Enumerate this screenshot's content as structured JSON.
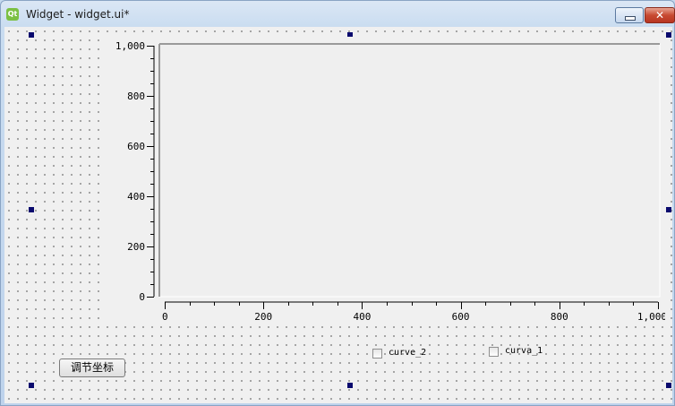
{
  "window": {
    "title": "Widget - widget.ui*",
    "app_icon_text": "Qt",
    "close_glyph": "✕"
  },
  "plot": {
    "y_axis": {
      "min": 0,
      "max": 1000,
      "major_step": 200,
      "minor_step": 50,
      "tick_labels": [
        "0",
        "200",
        "400",
        "600",
        "800",
        "1,000"
      ]
    },
    "x_axis": {
      "min": 0,
      "max": 1000,
      "major_step": 200,
      "minor_step": 50,
      "tick_labels": [
        "0",
        "200",
        "400",
        "600",
        "800",
        "1,000"
      ]
    }
  },
  "controls": {
    "adjust_button_label": "调节坐标",
    "checkboxes": [
      {
        "label": "curve_2",
        "checked": false
      },
      {
        "label": "curva_1",
        "checked": false
      }
    ]
  }
}
